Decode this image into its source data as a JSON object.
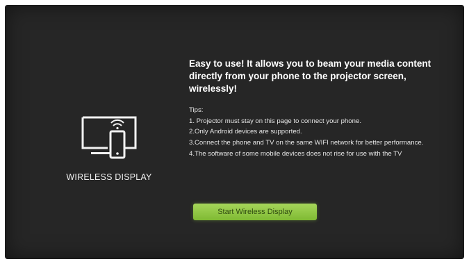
{
  "app": {
    "label": "WIRELESS DISPLAY",
    "icon": "screen-mirroring-icon"
  },
  "content": {
    "headline": "Easy to use! It allows you to beam your media content directly from your phone to the projector screen, wirelessly!",
    "tips_title": "Tips:",
    "tips": [
      "1. Projector must stay on this page to connect your phone.",
      "2.Only Android devices are supported.",
      "3.Connect the phone and TV on the same WIFI network for better performance.",
      "4.The software of some mobile devices does not rise for use with the TV"
    ]
  },
  "actions": {
    "start_label": "Start Wireless Display"
  },
  "colors": {
    "background": "#262626",
    "accent": "#8cc63f",
    "text": "#ffffff"
  }
}
